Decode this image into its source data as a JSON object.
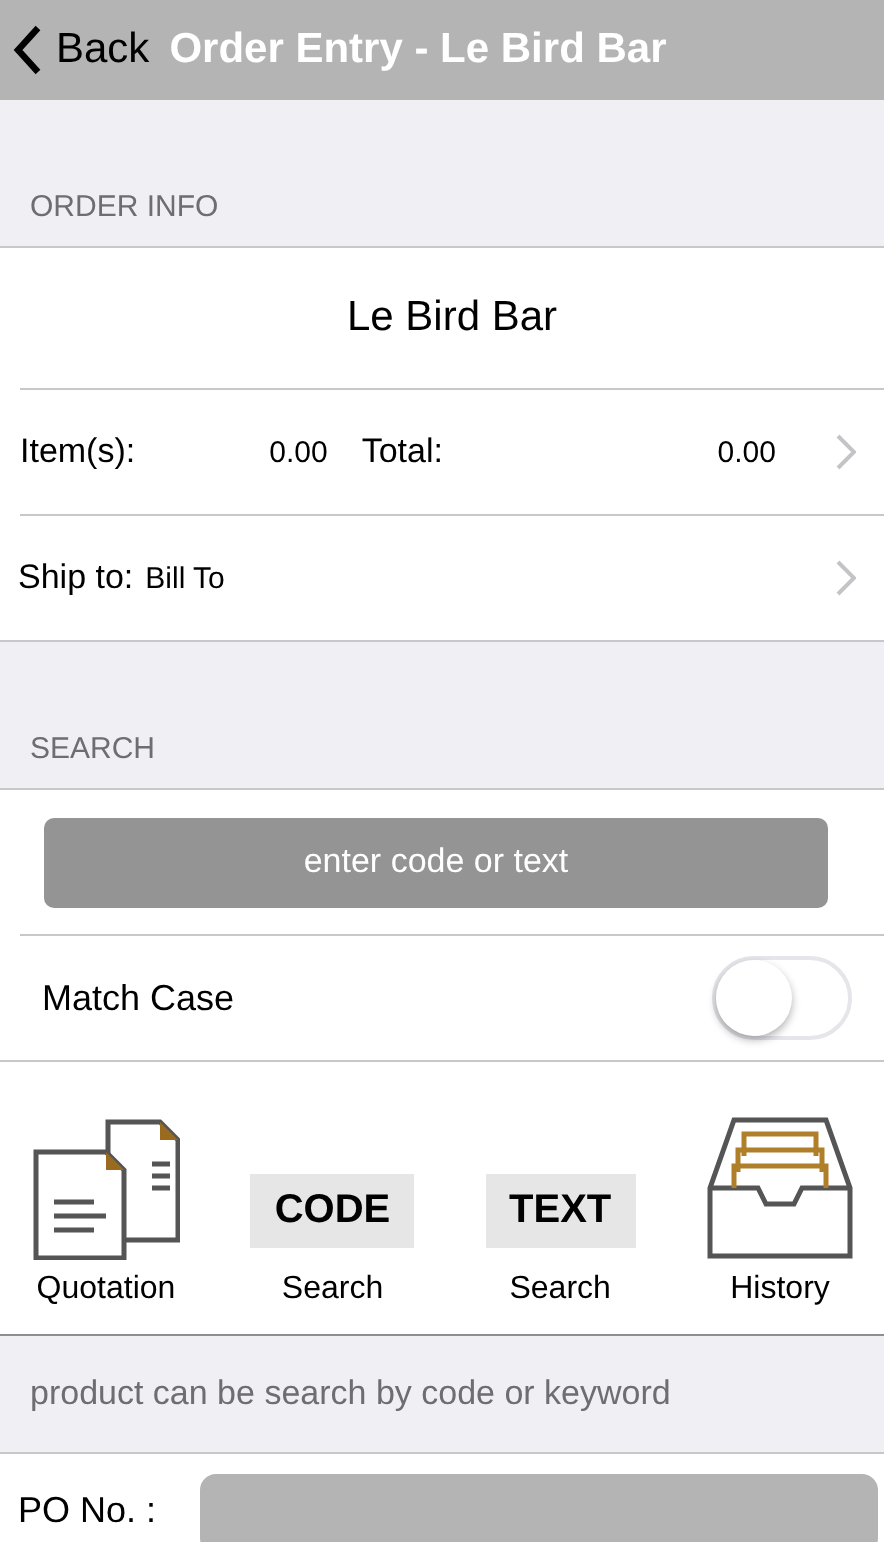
{
  "nav": {
    "back": "Back",
    "title": "Order Entry - Le Bird Bar"
  },
  "order_info": {
    "header": "ORDER INFO",
    "customer": "Le Bird Bar",
    "items_label": "Item(s):",
    "items_value": "0.00",
    "total_label": "Total:",
    "total_value": "0.00",
    "ship_label": "Ship to:",
    "ship_value": "Bill To"
  },
  "search": {
    "header": "SEARCH",
    "placeholder": "enter code or text",
    "match_case_label": "Match Case",
    "match_case_on": false
  },
  "actions": [
    {
      "kind": "quotation",
      "label": "Quotation"
    },
    {
      "kind": "code",
      "badge": "CODE",
      "label": "Search"
    },
    {
      "kind": "text",
      "badge": "TEXT",
      "label": "Search"
    },
    {
      "kind": "history",
      "label": "History"
    }
  ],
  "hint": "product can be search by code or keyword",
  "po": {
    "label": "PO No. :"
  }
}
